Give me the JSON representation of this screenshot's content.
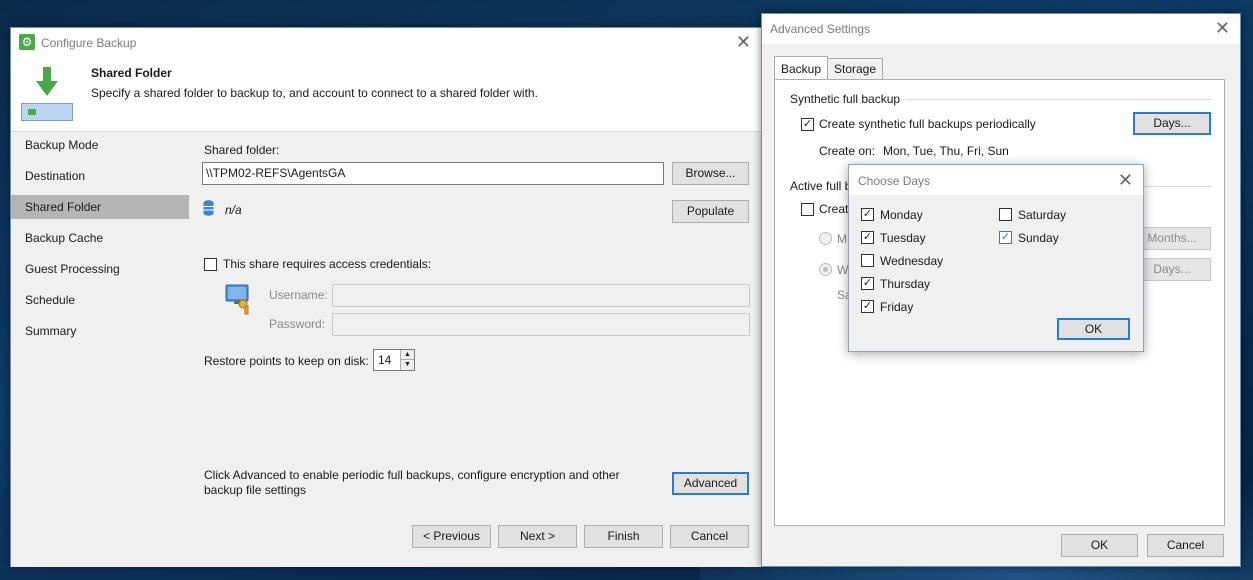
{
  "configure_backup": {
    "title": "Configure Backup",
    "step_title": "Shared Folder",
    "step_description": "Specify a shared folder to backup to, and account to connect to a shared folder with.",
    "nav": [
      {
        "label": "Backup Mode",
        "active": false
      },
      {
        "label": "Destination",
        "active": false
      },
      {
        "label": "Shared Folder",
        "active": true
      },
      {
        "label": "Backup Cache",
        "active": false
      },
      {
        "label": "Guest Processing",
        "active": false
      },
      {
        "label": "Schedule",
        "active": false
      },
      {
        "label": "Summary",
        "active": false
      }
    ],
    "shared_folder_label": "Shared folder:",
    "shared_folder_value": "\\\\TPM02-REFS\\AgentsGA",
    "browse_label": "Browse...",
    "capacity_value": "n/a",
    "populate_label": "Populate",
    "credentials_label": "This share requires access credentials:",
    "credentials_checked": false,
    "username_label": "Username:",
    "password_label": "Password:",
    "restore_points_label": "Restore points to keep on disk:",
    "restore_points_value": "14",
    "advanced_hint": "Click Advanced to enable periodic full backups, configure encryption and other backup file settings",
    "advanced_label": "Advanced",
    "previous_label": "< Previous",
    "next_label": "Next >",
    "finish_label": "Finish",
    "cancel_label": "Cancel"
  },
  "advanced_settings": {
    "title": "Advanced Settings",
    "tabs": [
      {
        "label": "Backup",
        "active": true
      },
      {
        "label": "Storage",
        "active": false
      }
    ],
    "synthetic_group": "Synthetic full backup",
    "synthetic_checkbox": "Create synthetic full backups periodically",
    "synthetic_checked": true,
    "days_label": "Days...",
    "create_on_label": "Create on:",
    "create_on_value": "Mon, Tue, Thu, Fri, Sun",
    "active_full_group": "Active full b",
    "active_full_checkbox": "Create",
    "radio_monthly": "M",
    "radio_weekly": "W",
    "weekly_sub": "Sa",
    "months_label": "Months...",
    "days2_label": "Days...",
    "ok_label": "OK",
    "cancel_label": "Cancel"
  },
  "choose_days": {
    "title": "Choose Days",
    "days": [
      {
        "label": "Monday",
        "checked": true
      },
      {
        "label": "Tuesday",
        "checked": true
      },
      {
        "label": "Wednesday",
        "checked": false
      },
      {
        "label": "Thursday",
        "checked": true
      },
      {
        "label": "Friday",
        "checked": true
      },
      {
        "label": "Saturday",
        "checked": false
      },
      {
        "label": "Sunday",
        "checked": true
      }
    ],
    "ok_label": "OK"
  },
  "colors": {
    "accent": "#2a7ad2",
    "nav_active": "#b5b5b5",
    "icon_green": "#4aa84a"
  }
}
